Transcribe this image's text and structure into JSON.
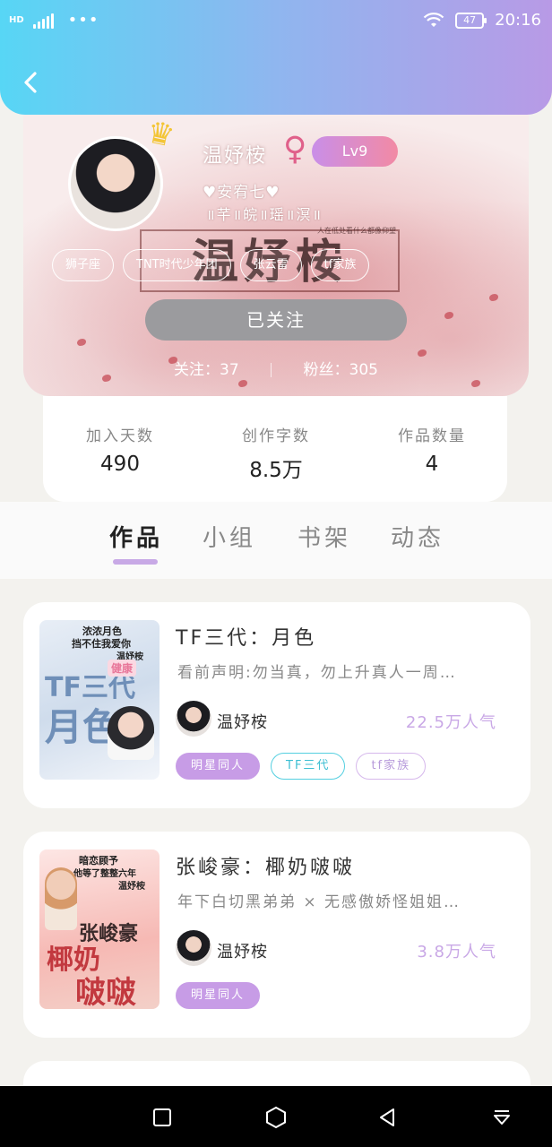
{
  "status_bar": {
    "network": "HD",
    "more": "•••",
    "battery": "47",
    "time": "20:16"
  },
  "header": {
    "back_icon": "chevron-left-icon"
  },
  "profile": {
    "username": "温妤桉",
    "level": "Lv9",
    "bio_line1": "♥安宥七♥",
    "bio_line2": "॥芊॥皖॥瑶॥溟॥",
    "background_text": "温妤桉",
    "background_caption": "人在低处看什么都像仰望",
    "tags": [
      "狮子座",
      "TNT时代少年团",
      "张云雷",
      "tf家族"
    ],
    "follow_button": "已关注",
    "following_label": "关注：37",
    "fans_label": "粉丝：305"
  },
  "stats": [
    {
      "label": "加入天数",
      "value": "490"
    },
    {
      "label": "创作字数",
      "value": "8.5万"
    },
    {
      "label": "作品数量",
      "value": "4"
    }
  ],
  "tabs": [
    "作品",
    "小组",
    "书架",
    "动态"
  ],
  "works": [
    {
      "title": "TF三代：月色",
      "desc": "看前声明:勿当真，勿上升真人一周…",
      "author": "温妤桉",
      "popularity": "22.5万人气",
      "tags": [
        "明星同人",
        "TF三代",
        "tf家族"
      ],
      "cover_lines": [
        "浓浓月色",
        "挡不住我爱你",
        "温妤桉",
        "TF三代",
        "月色",
        "健康"
      ]
    },
    {
      "title": "张峻豪：椰奶啵啵",
      "desc": "年下白切黑弟弟 × 无感傲娇怪姐姐…",
      "author": "温妤桉",
      "popularity": "3.8万人气",
      "tags": [
        "明星同人"
      ],
      "cover_lines": [
        "暗恋顾予",
        "他等了整整六年",
        "温妤桉",
        "张峻豪",
        "椰奶",
        "啵啵"
      ]
    }
  ],
  "colors": {
    "accent": "#c79ce6",
    "header_start": "#57d6f5",
    "header_end": "#b89ae6",
    "follow_button": "#9b9b9e"
  }
}
